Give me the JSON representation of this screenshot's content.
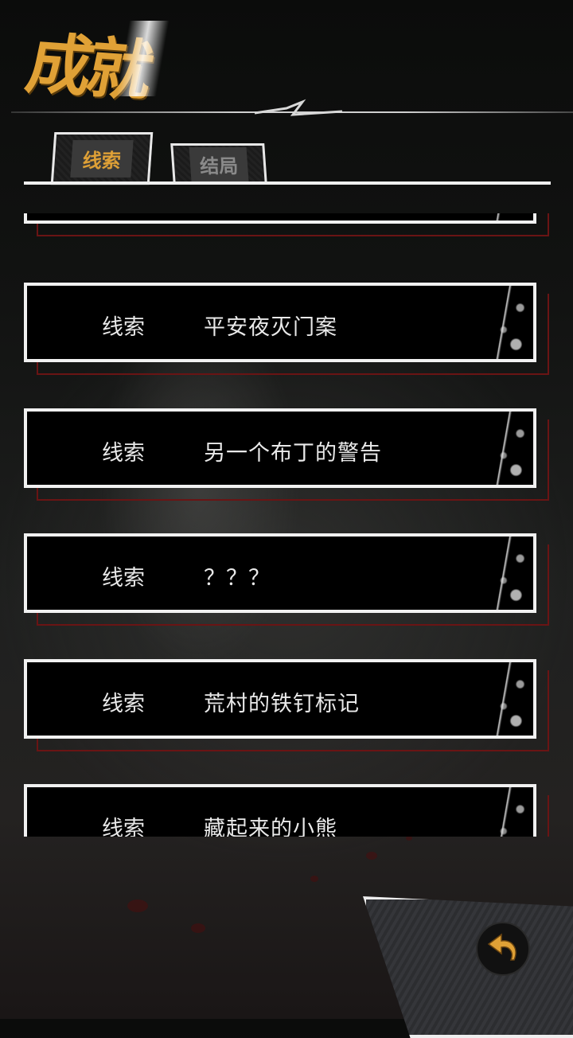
{
  "page_title": "成就",
  "tabs": [
    {
      "label": "线索",
      "active": true
    },
    {
      "label": "结局",
      "active": false
    }
  ],
  "achievements": [
    {
      "category": "",
      "name": ""
    },
    {
      "category": "线索",
      "name": "平安夜灭门案"
    },
    {
      "category": "线索",
      "name": "另一个布丁的警告"
    },
    {
      "category": "线索",
      "name": "？？？"
    },
    {
      "category": "线索",
      "name": "荒村的铁钉标记"
    },
    {
      "category": "线索",
      "name": "藏起来的小熊"
    }
  ],
  "back_button": {
    "icon": "back-arrow-icon"
  },
  "colors": {
    "accent": "#e0a136",
    "frame": "#f1f1f1",
    "shadow": "#6a1414"
  }
}
